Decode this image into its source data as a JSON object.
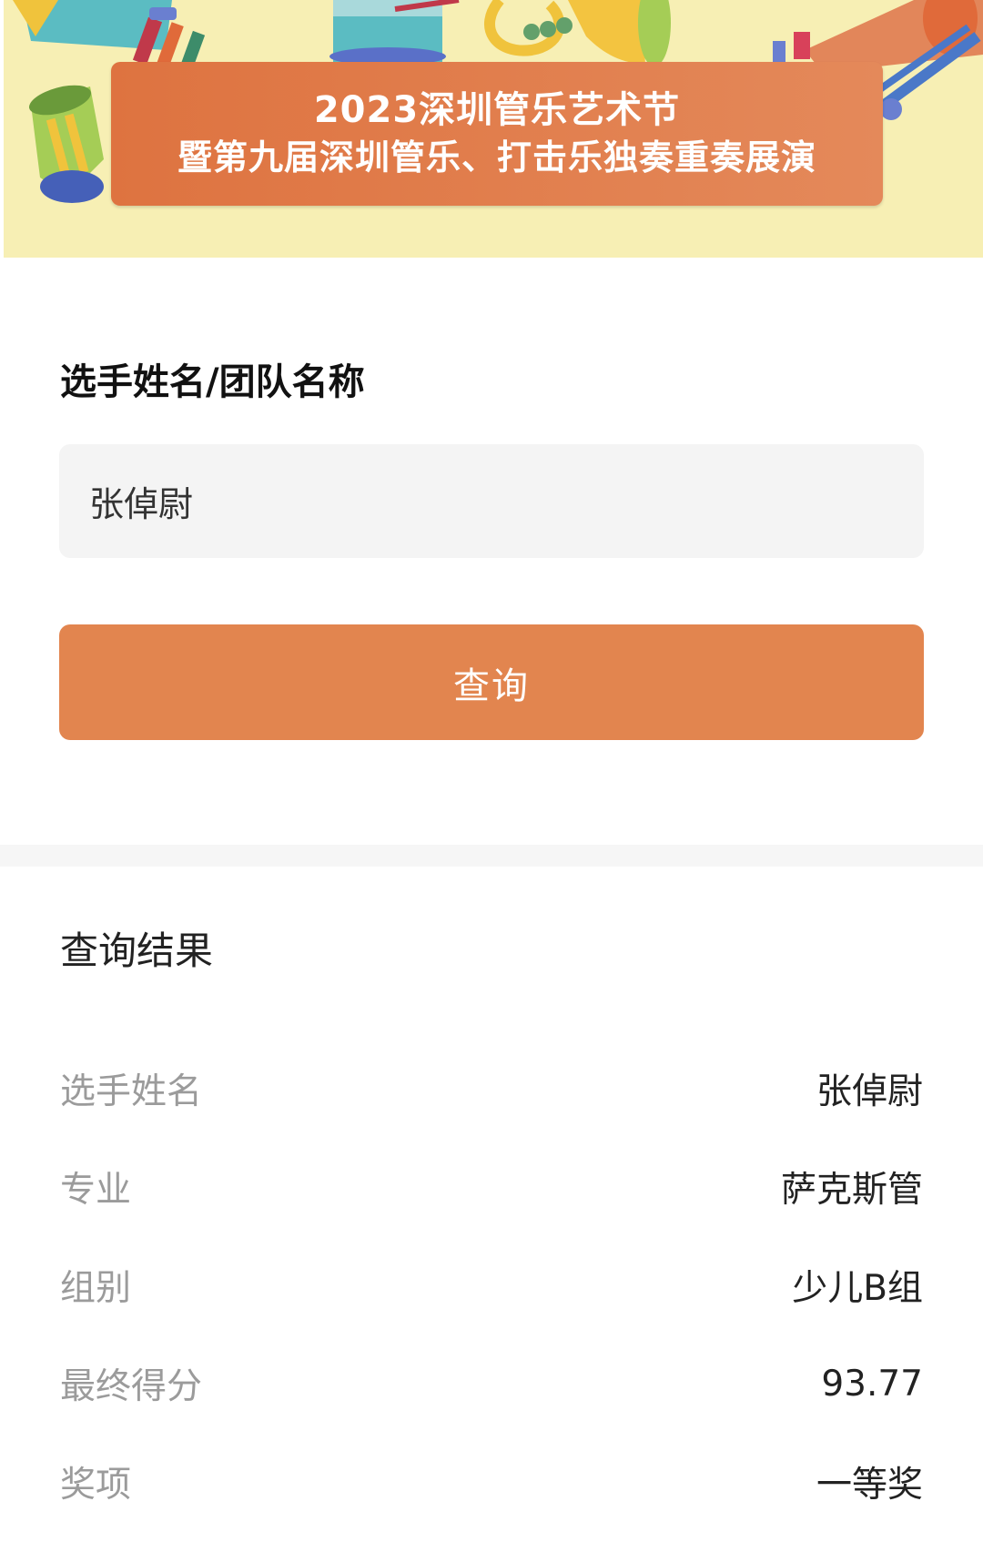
{
  "banner": {
    "title_line1": "2023深圳管乐艺术节",
    "title_line2": "暨第九届深圳管乐、打击乐独奏重奏展演"
  },
  "form": {
    "label": "选手姓名/团队名称",
    "input_value": "张倬尉",
    "button_label": "查询"
  },
  "results": {
    "title": "查询结果",
    "rows": [
      {
        "label": "选手姓名",
        "value": "张倬尉"
      },
      {
        "label": "专业",
        "value": "萨克斯管"
      },
      {
        "label": "组别",
        "value": "少儿B组"
      },
      {
        "label": "最终得分",
        "value": "93.77"
      },
      {
        "label": "奖项",
        "value": "一等奖"
      }
    ]
  },
  "colors": {
    "accent": "#e2854f",
    "banner_bg": "#f7efb4",
    "title_box": "#de7340"
  }
}
